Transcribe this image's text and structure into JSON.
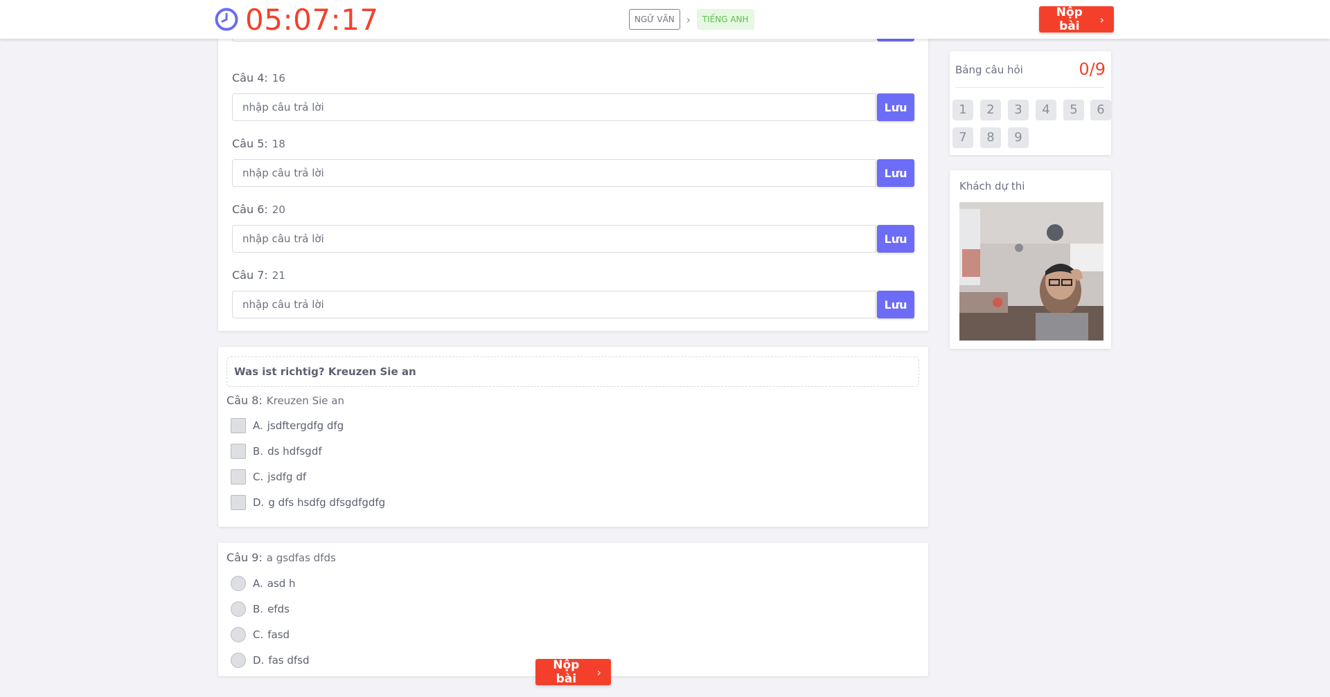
{
  "header": {
    "timer": "05:07:17",
    "subjects": [
      "NGỮ VĂN",
      "TIẾNG ANH"
    ],
    "submit_label": "Nộp bài"
  },
  "colors": {
    "accent_red": "#f4402a",
    "save_purple": "#6c6cf6",
    "clock_purple": "#6b6cf2",
    "tag_green": "#5cc14d"
  },
  "answer_placeholder": "nhập câu trả lời",
  "save_label": "Lưu",
  "fill_questions": [
    {
      "label": "Câu 4:",
      "text": "16"
    },
    {
      "label": "Câu 5:",
      "text": "18"
    },
    {
      "label": "Câu 6:",
      "text": "20"
    },
    {
      "label": "Câu 7:",
      "text": "21"
    }
  ],
  "group": {
    "header": "Was ist richtig? Kreuzen Sie an",
    "question": {
      "label": "Câu 8:",
      "text": "Kreuzen Sie an",
      "options": [
        {
          "letter": "A.",
          "text": "jsdftergdfg dfg"
        },
        {
          "letter": "B.",
          "text": "ds hdfsgdf"
        },
        {
          "letter": "C.",
          "text": "jsdfg df"
        },
        {
          "letter": "D.",
          "text": "g dfs hsdfg dfsgdfgdfg"
        }
      ]
    }
  },
  "question9": {
    "label": "Câu 9:",
    "text": "a gsdfas dfds",
    "options": [
      {
        "letter": "A.",
        "text": "asd h"
      },
      {
        "letter": "B.",
        "text": "efds"
      },
      {
        "letter": "C.",
        "text": "fasd"
      },
      {
        "letter": "D.",
        "text": "fas dfsd"
      }
    ]
  },
  "question_panel": {
    "title": "Bảng câu hỏi",
    "count": "0/9",
    "numbers": [
      "1",
      "2",
      "3",
      "4",
      "5",
      "6",
      "7",
      "8",
      "9"
    ]
  },
  "camera_panel": {
    "title": "Khách dự thi"
  }
}
